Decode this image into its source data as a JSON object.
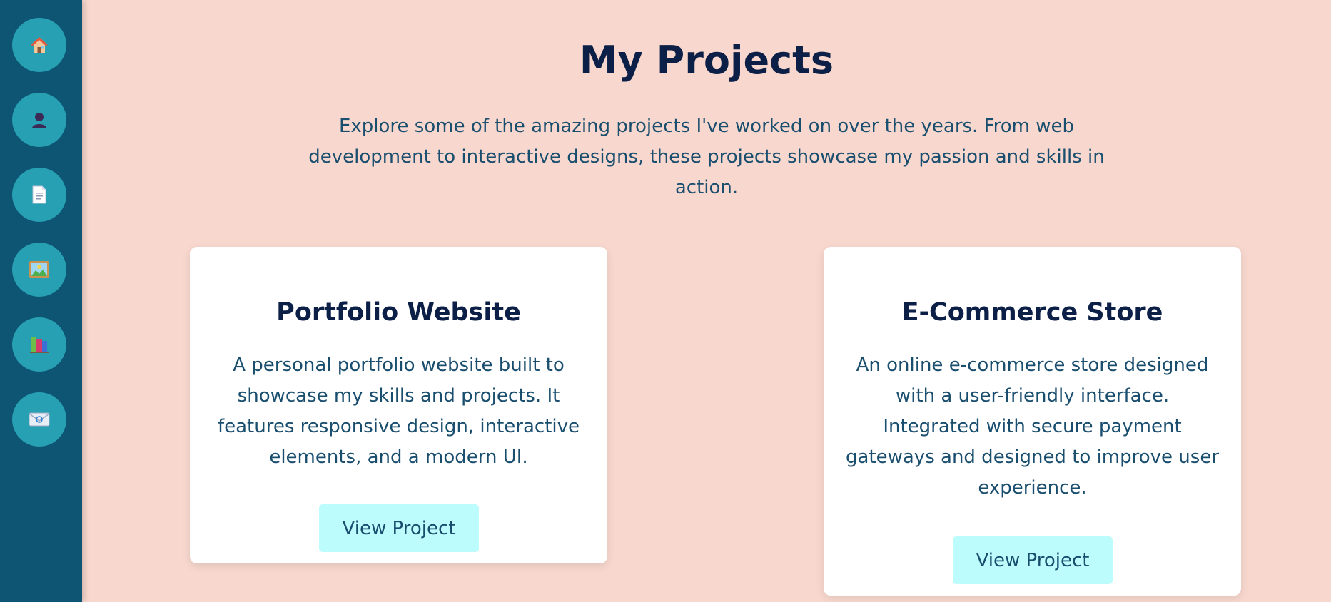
{
  "sidebar": {
    "items": [
      {
        "icon": "home-icon",
        "emoji": "🏠"
      },
      {
        "icon": "user-icon",
        "emoji": "👤"
      },
      {
        "icon": "document-icon",
        "emoji": "📄"
      },
      {
        "icon": "image-icon",
        "emoji": "🖼"
      },
      {
        "icon": "books-icon",
        "emoji": "📚"
      },
      {
        "icon": "mail-icon",
        "emoji": "📧"
      }
    ],
    "background": "#0d5573",
    "button_color": "#26a0b2"
  },
  "main": {
    "title": "My Projects",
    "intro": "Explore some of the amazing projects I've worked on over the years. From web development to interactive designs, these projects showcase my passion and skills in action.",
    "projects": [
      {
        "title": "Portfolio Website",
        "description": "A personal portfolio website built to showcase my skills and projects. It features responsive design, interactive elements, and a modern UI.",
        "button_label": "View Project"
      },
      {
        "title": "E-Commerce Store",
        "description": "An online e-commerce store designed with a user-friendly interface. Integrated with secure payment gateways and designed to improve user experience.",
        "button_label": "View Project"
      }
    ]
  },
  "colors": {
    "page_background": "#f8d8ce",
    "heading": "#0b1f47",
    "body_text": "#1a4e6e",
    "button": "#bcfcfd",
    "card": "#ffffff"
  }
}
